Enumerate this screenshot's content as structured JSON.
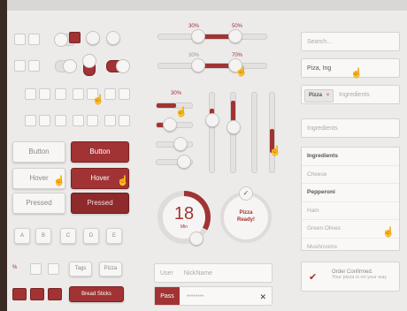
{
  "colors": {
    "accent": "#a13334",
    "background": "#ecebea"
  },
  "buttons": {
    "button_label": "Button",
    "button_active_label": "Button",
    "hover_label": "Hover",
    "hover_active_label": "Hover",
    "pressed_label": "Pressed",
    "pressed_active_label": "Pressed"
  },
  "letter_keys": [
    "A",
    "B",
    "C",
    "D",
    "E"
  ],
  "bottom_controls": {
    "percent_label": "%",
    "tags_label": "Tags",
    "pizza_label": "Pizza",
    "breadcrumbs_label": "Bread Sticks"
  },
  "range_sliders": {
    "first": {
      "low": "30%",
      "high": "50%"
    },
    "second": {
      "low": "30%",
      "high": "70%"
    }
  },
  "small_sliders": {
    "first_label": "30%"
  },
  "ring_timer": {
    "value": "18",
    "unit": "Min",
    "progress": 0.33
  },
  "ring_ready": {
    "line1": "Pizza",
    "line2": "Ready!"
  },
  "user_field": {
    "label": "User",
    "value": "NickName"
  },
  "pass_field": {
    "label": "Pass",
    "value": "••••••••",
    "clear_icon": "close-icon"
  },
  "search": {
    "placeholder": "Search..."
  },
  "typed_field": {
    "value": "Piza, Ing"
  },
  "tag_field": {
    "chip": "Pizza",
    "chip_remove": "×",
    "placeholder": "Ingredients"
  },
  "dropdown": {
    "label": "Ingredients"
  },
  "list": {
    "items": [
      {
        "label": "Ingredients"
      },
      {
        "label": "Cheese"
      },
      {
        "label": "Pepperoni"
      },
      {
        "label": "Ham"
      },
      {
        "label": "Green Olives"
      },
      {
        "label": "Mushrooms"
      }
    ]
  },
  "notification": {
    "title": "Order Confirmed.",
    "subtitle": "Your pizza is on your way"
  }
}
